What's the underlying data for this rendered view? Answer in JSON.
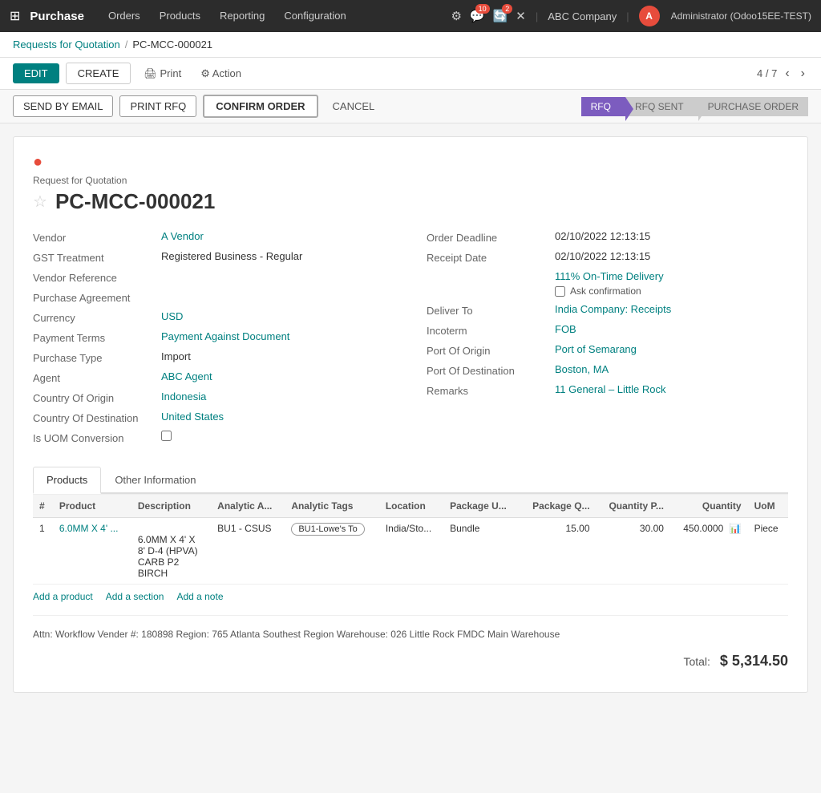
{
  "topNav": {
    "appName": "Purchase",
    "navItems": [
      "Orders",
      "Products",
      "Reporting",
      "Configuration"
    ],
    "icons": {
      "settings": "⚙",
      "chat": "💬",
      "chatBadge": "10",
      "refresh": "🔄",
      "refreshBadge": "2",
      "close": "✕"
    },
    "company": "ABC Company",
    "userInitial": "A",
    "userName": "Administrator (Odoo15EE-TEST)"
  },
  "breadcrumb": {
    "parent": "Requests for Quotation",
    "separator": "/",
    "current": "PC-MCC-000021"
  },
  "actionBar": {
    "editLabel": "EDIT",
    "createLabel": "CREATE",
    "printLabel": "🖨 Print",
    "actionLabel": "⚙ Action",
    "pagination": "4 / 7"
  },
  "statusBar": {
    "sendByEmailLabel": "SEND BY EMAIL",
    "printRfqLabel": "PRINT RFQ",
    "confirmOrderLabel": "CONFIRM ORDER",
    "cancelLabel": "CANCEL",
    "steps": [
      {
        "label": "RFQ",
        "active": true
      },
      {
        "label": "RFQ SENT",
        "active": false
      },
      {
        "label": "PURCHASE ORDER",
        "active": false
      }
    ]
  },
  "form": {
    "subtitle": "Request for Quotation",
    "title": "PC-MCC-000021",
    "leftFields": [
      {
        "label": "Vendor",
        "value": "A Vendor",
        "isLink": true
      },
      {
        "label": "GST Treatment",
        "value": "Registered Business - Regular",
        "isLink": false
      },
      {
        "label": "Vendor Reference",
        "value": "",
        "isLink": false
      },
      {
        "label": "Purchase Agreement",
        "value": "",
        "isLink": false
      },
      {
        "label": "Currency",
        "value": "USD",
        "isLink": true
      },
      {
        "label": "Payment Terms",
        "value": "Payment Against Document",
        "isLink": true
      },
      {
        "label": "Purchase Type",
        "value": "Import",
        "isLink": false
      },
      {
        "label": "Agent",
        "value": "ABC Agent",
        "isLink": true
      },
      {
        "label": "Country Of Origin",
        "value": "Indonesia",
        "isLink": true
      },
      {
        "label": "Country Of Destination",
        "value": "United States",
        "isLink": true
      },
      {
        "label": "Is UOM Conversion",
        "value": "checkbox",
        "isLink": false
      }
    ],
    "rightFields": [
      {
        "label": "Order Deadline",
        "value": "02/10/2022 12:13:15",
        "isLink": false
      },
      {
        "label": "Receipt Date",
        "value": "02/10/2022 12:13:15",
        "isLink": false
      },
      {
        "label": "onTimeDelivery",
        "value": "111% On-Time Delivery",
        "isLink": true
      },
      {
        "label": "askConfirmation",
        "value": "Ask confirmation",
        "isLink": false
      },
      {
        "label": "Deliver To",
        "value": "India Company: Receipts",
        "isLink": true
      },
      {
        "label": "Incoterm",
        "value": "FOB",
        "isLink": true
      },
      {
        "label": "Port Of Origin",
        "value": "Port of Semarang",
        "isLink": true
      },
      {
        "label": "Port Of Destination",
        "value": "Boston, MA",
        "isLink": true
      },
      {
        "label": "Remarks",
        "value": "11 General – Little Rock",
        "isLink": true
      }
    ]
  },
  "tabs": [
    {
      "label": "Products",
      "active": true
    },
    {
      "label": "Other Information",
      "active": false
    }
  ],
  "table": {
    "columns": [
      "#",
      "Product",
      "Description",
      "Analytic A...",
      "Analytic Tags",
      "Location",
      "Package U...",
      "Package Q...",
      "Quantity P...",
      "Quantity",
      "UoM"
    ],
    "rows": [
      {
        "num": "1",
        "product": "6.0MM X 4' ...",
        "description": "6.0MM X 4' X\n8' D-4 (HPVA)\nCARB P2\nBIRCH",
        "analyticA": "BU1 - CSUS",
        "analyticTags": "BU1-Lowe's To",
        "location": "India/Sto...",
        "packageU": "Bundle",
        "packageQ": "15.00",
        "quantityP": "30.00",
        "quantity": "450.0000",
        "uom": "Piece"
      }
    ],
    "addLinks": [
      "Add a product",
      "Add a section",
      "Add a note"
    ]
  },
  "footer": {
    "attnText": "Attn: Workflow Vender #: 180898 Region: 765 Atlanta Southest Region Warehouse: 026 Little Rock FMDC Main Warehouse",
    "totalLabel": "Total:",
    "totalValue": "$ 5,314.50"
  }
}
